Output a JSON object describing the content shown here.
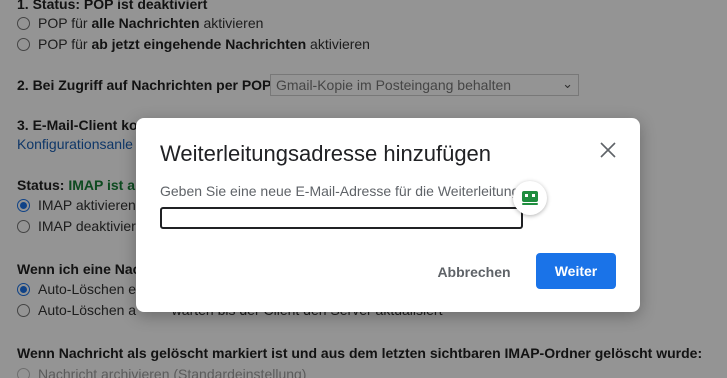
{
  "pop": {
    "status_heading": "1. Status: POP ist deaktiviert",
    "option_all_prefix": "POP für ",
    "option_all_bold": "alle Nachrichten",
    "option_all_suffix": " aktivieren",
    "option_new_prefix": "POP für ",
    "option_new_bold": "ab jetzt eingehende Nachrichten",
    "option_new_suffix": " aktivieren",
    "access_heading": "2. Bei Zugriff auf Nachrichten per POP",
    "access_select_value": "Gmail-Kopie im Posteingang behalten",
    "client_heading": "3. E-Mail-Client ko",
    "client_link": "Konfigurationsanle"
  },
  "imap": {
    "status_prefix": "Status: ",
    "status_value": "IMAP ist al",
    "option_enable": "IMAP aktivieren",
    "option_disable": "IMAP deaktivier",
    "delete_heading": "Wenn ich eine Nach",
    "autodelete_on": "Auto-Löschen e",
    "autodelete_off": "Auto-Löschen a",
    "autodelete_off_tail": "– warten bis der Client den Server aktualisiert",
    "expunge_heading": "Wenn Nachricht als gelöscht markiert ist und aus dem letzten sichtbaren IMAP-Ordner gelöscht wurde:",
    "expunge_archive": "Nachricht archivieren (Standardeinstellung)"
  },
  "dialog": {
    "title": "Weiterleitungsadresse hinzufügen",
    "label": "Geben Sie eine neue E-Mail-Adresse für die Weiterleitung an:",
    "input_value": "",
    "cancel_label": "Abbrechen",
    "next_label": "Weiter",
    "close_icon": "close-icon",
    "extension_icon": "password-manager-icon"
  },
  "colors": {
    "accent": "#1a73e8",
    "status_green": "#188038",
    "extension_green": "#1e8e3e"
  }
}
